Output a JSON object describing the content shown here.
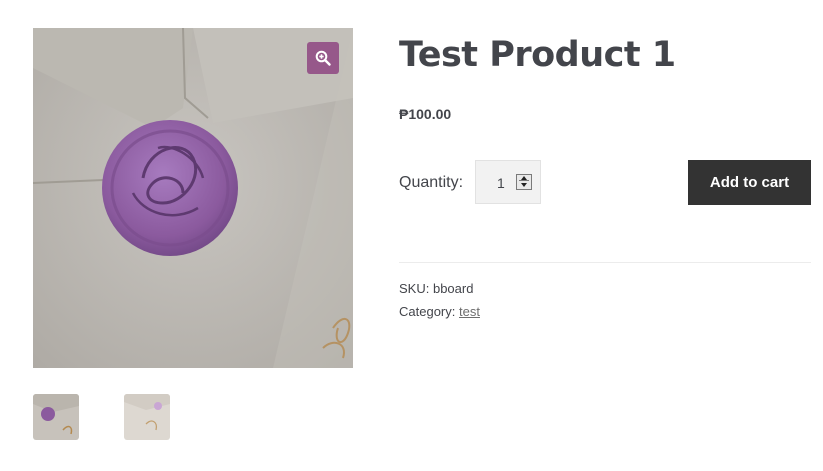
{
  "product": {
    "title": "Test Product 1",
    "price": "₱100.00",
    "quantity_label": "Quantity:",
    "quantity_value": "1",
    "add_to_cart_label": "Add to cart",
    "sku_label": "SKU:",
    "sku_value": "bboard",
    "category_label": "Category:",
    "category_value": "test"
  },
  "gallery": {
    "zoom_icon": "zoom-in-icon",
    "thumbnails": [
      "wax-seal-thumbnail-1",
      "wax-seal-thumbnail-2"
    ]
  },
  "colors": {
    "accent": "#96588a",
    "button_bg": "#333333",
    "text": "#43454b",
    "wax_seal": "#8e5fa0"
  }
}
